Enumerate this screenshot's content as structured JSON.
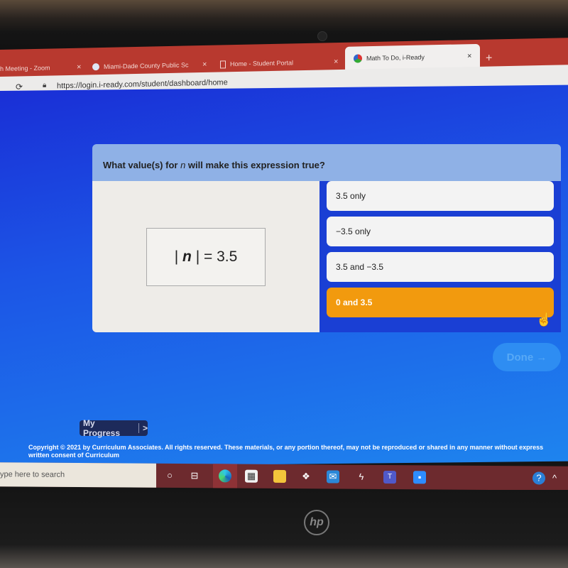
{
  "browser": {
    "tabs": [
      {
        "label": "h Meeting - Zoom",
        "active": false
      },
      {
        "label": "Miami-Dade County Public Sc",
        "active": false
      },
      {
        "label": "Home - Student Portal",
        "active": false
      },
      {
        "label": "Math To Do, i-Ready",
        "active": true
      }
    ],
    "close_glyph": "×",
    "new_tab_glyph": "+",
    "url": "https://login.i-ready.com/student/dashboard/home"
  },
  "question": {
    "prompt_before": "What value(s) for ",
    "variable": "n",
    "prompt_after": " will make this expression true?",
    "expression_left": "|",
    "expression_var": "n",
    "expression_right": "| = 3.5",
    "options": [
      {
        "label": "3.5 only",
        "selected": false
      },
      {
        "label": "−3.5 only",
        "selected": false
      },
      {
        "label": "3.5 and −3.5",
        "selected": false
      },
      {
        "label": "0 and 3.5",
        "selected": true
      }
    ],
    "done_label": "Done →"
  },
  "footer": {
    "my_progress": "My Progress",
    "my_progress_arrow": ">",
    "copyright": "Copyright © 2021 by Curriculum Associates. All rights reserved. These materials, or any portion thereof, may not be reproduced or shared in any manner without express written consent of Curriculum"
  },
  "taskbar": {
    "search_placeholder": "ype here to search",
    "icons": [
      "cortana-icon",
      "task-view-icon",
      "edge-icon",
      "store-icon",
      "file-explorer-icon",
      "dropbox-icon",
      "mail-icon",
      "app-icon",
      "teams-icon",
      "zoom-icon"
    ]
  },
  "colors": {
    "selected": "#f29a0e",
    "tabbar": "#b8392f",
    "page": "#1c55e6"
  },
  "logo": "hp"
}
